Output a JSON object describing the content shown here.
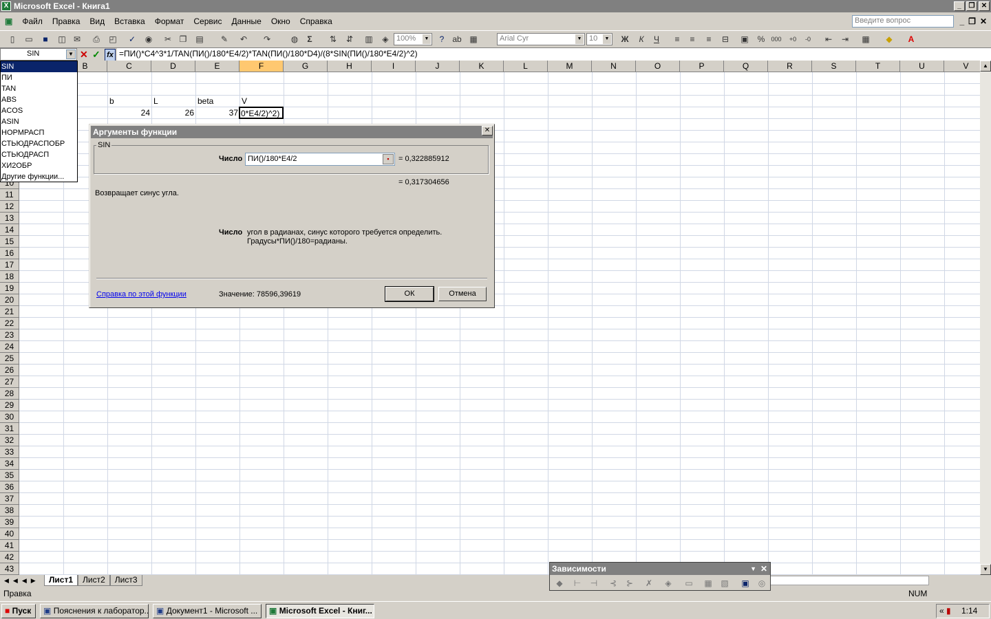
{
  "window": {
    "title": "Microsoft Excel - Книга1",
    "minimize": "_",
    "restore": "❐",
    "close": "✕"
  },
  "menu": [
    "Файл",
    "Правка",
    "Вид",
    "Вставка",
    "Формат",
    "Сервис",
    "Данные",
    "Окно",
    "Справка"
  ],
  "question_placeholder": "Введите вопрос",
  "toolbar": {
    "zoom": "100%",
    "font": "Arial Cyr",
    "size": "10",
    "bold": "Ж",
    "italic": "К",
    "underline": "Ч"
  },
  "formula": {
    "namebox": "SIN",
    "text": "=ПИ()*C4^3*1/TAN(ПИ()/180*E4/2)*TAN(ПИ()/180*D4)/(8*SIN(ПИ()/180*E4/2)^2)"
  },
  "columns": [
    "B",
    "C",
    "D",
    "E",
    "F",
    "G",
    "H",
    "I",
    "J",
    "K",
    "L",
    "M",
    "N",
    "O",
    "P",
    "Q",
    "R",
    "S",
    "T",
    "U",
    "V"
  ],
  "rows": [
    "10",
    "11",
    "12",
    "13",
    "14",
    "15",
    "16",
    "17",
    "18",
    "19",
    "20",
    "21",
    "22",
    "23",
    "24",
    "25",
    "26",
    "27",
    "28",
    "29",
    "30",
    "31",
    "32",
    "33",
    "34",
    "35",
    "36",
    "37",
    "38",
    "39",
    "40",
    "41",
    "42",
    "43"
  ],
  "cells": {
    "c3": "b",
    "d3": "L",
    "e3": "beta",
    "f3": "V",
    "c4": "24",
    "d4": "26",
    "e4": "37",
    "f4": "0*E4/2)^2)"
  },
  "function_list": [
    "SIN",
    "ПИ",
    "TAN",
    "ABS",
    "ACOS",
    "ASIN",
    "НОРМРАСП",
    "СТЬЮДРАСПОБР",
    "СТЬЮДРАСП",
    "ХИ2ОБР",
    "Другие функции..."
  ],
  "dialog": {
    "title": "Аргументы функции",
    "function_name": "SIN",
    "arg_label": "Число",
    "arg_value": "ПИ()/180*E4/2",
    "arg_result": "= 0,322885912",
    "func_result": "= 0,317304656",
    "description": "Возвращает синус угла.",
    "arg_help_label": "Число",
    "arg_help_1": "угол в радианах, синус которого требуется определить.",
    "arg_help_2": "Градусы*ПИ()/180=радианы.",
    "help_link": "Справка по этой функции",
    "value": "Значение: 78596,39619",
    "ok": "ОК",
    "cancel": "Отмена"
  },
  "sheets": [
    "Лист1",
    "Лист2",
    "Лист3"
  ],
  "status": {
    "left": "Правка",
    "num": "NUM"
  },
  "deps_toolbar": {
    "title": "Зависимости"
  },
  "taskbar": {
    "start": "Пуск",
    "items": [
      "Пояснения к лаборатор...",
      "Документ1 - Microsoft ...",
      "Microsoft Excel - Книг..."
    ],
    "clock": "1:14"
  }
}
